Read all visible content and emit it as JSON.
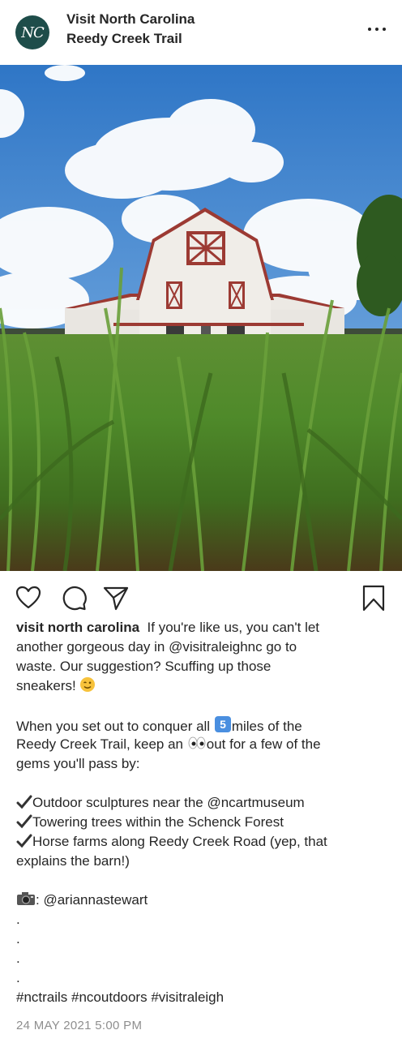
{
  "header": {
    "avatar_text": "NC",
    "account_name": "Visit North Carolina",
    "location": "Reedy Creek Trail",
    "more_icon": "more-horizontal-icon"
  },
  "post": {
    "image_alt": "white barn with red trim behind tall green grass",
    "actions": [
      "heart-icon",
      "comment-icon",
      "share-icon",
      "bookmark-icon"
    ],
    "caption": {
      "username": "visit north carolina",
      "line1": "If you're like us, you can't let",
      "line2": "another gorgeous day in @visitraleighnc go to",
      "line3": "waste. Our suggestion? Scuffing up those",
      "line4": "sneakers!",
      "para2_line1_a": "When you set out to conquer all",
      "para2_line1_b": "miles of the",
      "para2_line2_a": "Reedy Creek Trail, keep an",
      "para2_line2_b": "out for a few of the",
      "para2_line3": "gems you'll pass by:",
      "item1": "Outdoor sculptures near the @ncartmuseum",
      "item2": "Towering trees within the Schenck Forest",
      "item3": "Horse farms along Reedy Creek Road (yep, that",
      "item3_cont": "explains the barn!)",
      "credit": ": @ariannastewart",
      "dot": ".",
      "hashtags": "#nctrails #ncoutdoors #visitraleigh"
    },
    "five_emoji": "5",
    "date": "24 MAY 2021 5:00 PM"
  },
  "colors": {
    "avatar_bg": "#1e4d4a",
    "text": "#262626",
    "muted": "#8e8e8e",
    "sky": "#3f86d1",
    "grass": "#4f8a2a",
    "barn_trim": "#9c3a33"
  }
}
